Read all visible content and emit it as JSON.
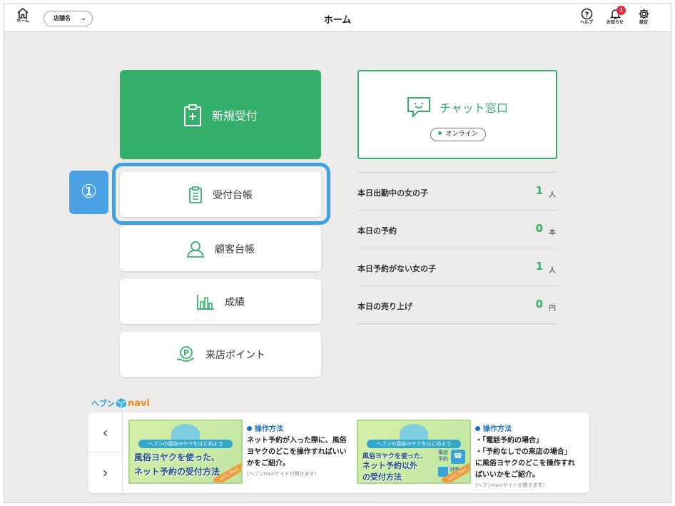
{
  "header": {
    "home_label": "ホーム",
    "store_select": "店舗名",
    "title": "ホーム",
    "help_label": "ヘルプ",
    "notice_label": "お知らせ",
    "notice_count": "1",
    "settings_label": "設定"
  },
  "menu": {
    "new_reception": "新規受付",
    "reception_ledger": "受付台帳",
    "customer_ledger": "顧客台帳",
    "results": "成績",
    "visit_points": "来店ポイント"
  },
  "step_marker": "①",
  "chat": {
    "title": "チャット窓口",
    "status": "オンライン"
  },
  "stats": [
    {
      "label": "本日出勤中の女の子",
      "value": "1",
      "unit": "人"
    },
    {
      "label": "本日の予約",
      "value": "0",
      "unit": "本"
    },
    {
      "label": "本日予約がない女の子",
      "value": "1",
      "unit": "人"
    },
    {
      "label": "本日の売り上げ",
      "value": "0",
      "unit": "円"
    }
  ],
  "navi": {
    "prefix": "ヘブン",
    "word": "navi"
  },
  "banners": [
    {
      "ribbon": "ヘブンの風俗ヨヤクをはじめよう",
      "line1": "風俗ヨヤクを使った、",
      "line2": "ネット予約の受付方法",
      "tag": "Let's Start",
      "heading": "操作方法",
      "body1": "ネット予約が入った際に、風俗",
      "body2": "ヨヤクのどこを操作すればいい",
      "body3": "かをご紹介。",
      "note": "(ヘブンnaviサイトが開きます)"
    },
    {
      "ribbon": "ヘブンの風俗ヨヤクをはじめよう",
      "line1": "風俗ヨヤクを使った、",
      "line2": "ネット予約以外",
      "line3": "の受付方法",
      "mini1": "電話",
      "mini2": "予約",
      "mini3": "対面",
      "mini4": "受付",
      "tag": "Let's Start",
      "heading": "操作方法",
      "body1": "・「電話予約の場合」",
      "body2": "・「予約なしでの来店の場合」",
      "body3": "に風俗ヨヤクのどこを操作すれ",
      "body4": "ばいいかをご紹介。",
      "note": "(ヘブンnaviサイトが開きます)"
    }
  ],
  "colors": {
    "green": "#35b06b",
    "highlight_blue": "#3fa0e6",
    "badge_red": "#e02c3c"
  }
}
